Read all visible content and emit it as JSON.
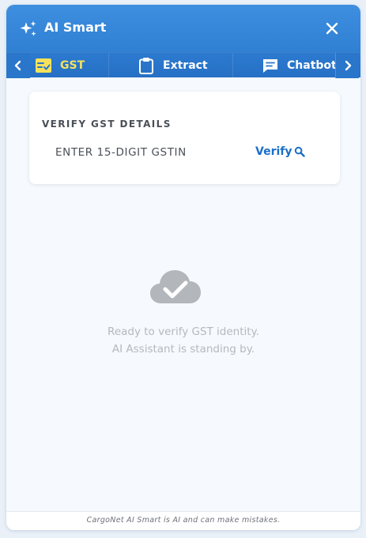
{
  "header": {
    "title": "AI Smart",
    "sparkle_icon": "sparkles-icon",
    "close_icon": "close-icon"
  },
  "tabs": {
    "items": [
      {
        "label": "GST",
        "icon": "checklist-icon",
        "active": true
      },
      {
        "label": "Extract",
        "icon": "clipboard-icon",
        "active": false
      },
      {
        "label": "Chatbot",
        "icon": "chat-icon",
        "active": false
      }
    ],
    "prev_icon": "chevron-left-icon",
    "next_icon": "chevron-right-icon"
  },
  "verify_card": {
    "heading": "VERIFY GST DETAILS",
    "gstin_value": "",
    "gstin_placeholder": "ENTER 15-DIGIT GSTIN",
    "verify_label": "Verify",
    "verify_icon": "search-icon"
  },
  "empty_state": {
    "icon": "cloud-check-icon",
    "line1": "Ready to verify GST identity.",
    "line2": "AI Assistant is standing by."
  },
  "footer": {
    "disclaimer": "CargoNet AI Smart is AI and can make mistakes."
  },
  "colors": {
    "header_blue": "#3e8fe0",
    "tab_blue": "#2a76cb",
    "active_tab_yellow": "#f6e25a",
    "link_blue": "#1b6fc6",
    "panel_bg": "#f6f9fd"
  }
}
